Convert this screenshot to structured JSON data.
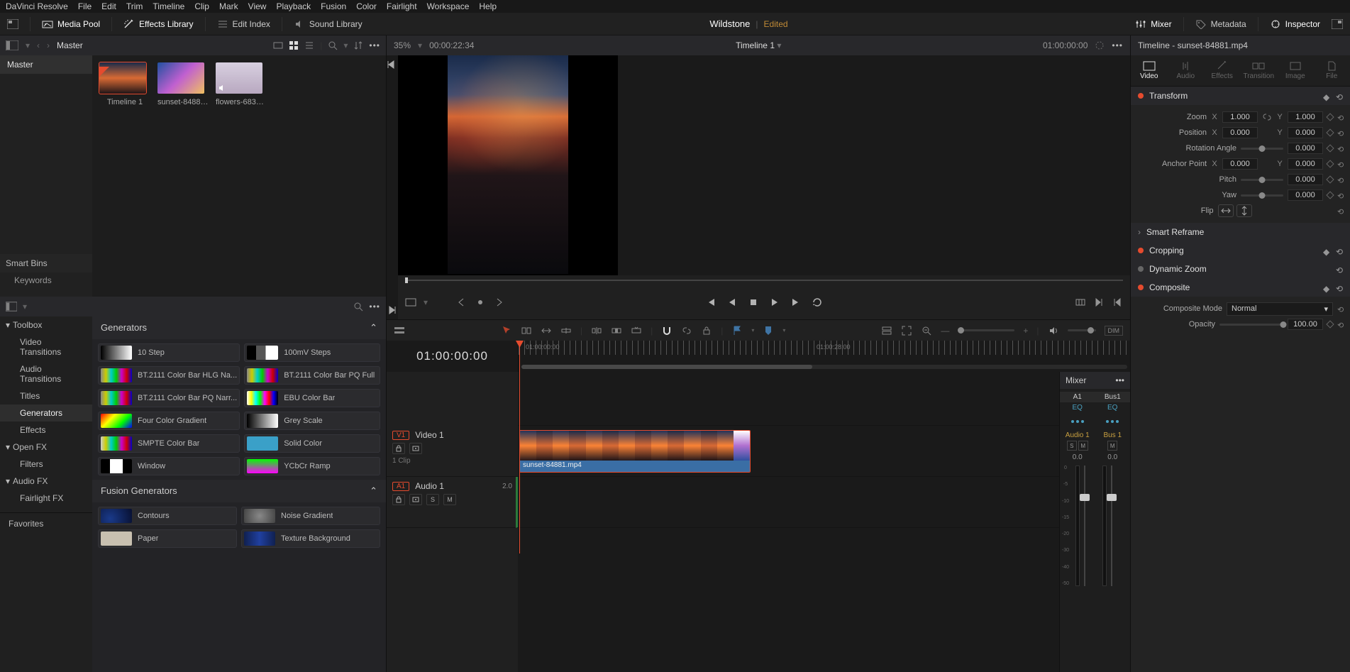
{
  "menu": [
    "DaVinci Resolve",
    "File",
    "Edit",
    "Trim",
    "Timeline",
    "Clip",
    "Mark",
    "View",
    "Playback",
    "Fusion",
    "Color",
    "Fairlight",
    "Workspace",
    "Help"
  ],
  "toolbar": {
    "media_pool": "Media Pool",
    "effects_lib": "Effects Library",
    "edit_index": "Edit Index",
    "sound_lib": "Sound Library",
    "mixer": "Mixer",
    "metadata": "Metadata",
    "inspector": "Inspector"
  },
  "project": {
    "name": "Wildstone",
    "status": "Edited"
  },
  "pool": {
    "title": "Master",
    "bin": "Master",
    "smart_bins": "Smart Bins",
    "keywords": "Keywords",
    "thumbs": [
      {
        "label": "Timeline 1",
        "selected": true,
        "type": "timeline"
      },
      {
        "label": "sunset-84881...",
        "type": "sunset"
      },
      {
        "label": "flowers-6836...",
        "type": "flowers"
      }
    ]
  },
  "fx": {
    "favorites": "Favorites",
    "cats": [
      {
        "label": "Toolbox",
        "group": true
      },
      {
        "label": "Video Transitions",
        "sub": true
      },
      {
        "label": "Audio Transitions",
        "sub": true
      },
      {
        "label": "Titles",
        "sub": true
      },
      {
        "label": "Generators",
        "sub": true,
        "sel": true
      },
      {
        "label": "Effects",
        "sub": true
      },
      {
        "label": "Open FX",
        "group": true
      },
      {
        "label": "Filters",
        "sub": true
      },
      {
        "label": "Audio FX",
        "group": true
      },
      {
        "label": "Fairlight FX",
        "sub": true
      }
    ],
    "sect1": "Generators",
    "items1": [
      {
        "name": "10 Step",
        "sw": "linear-gradient(90deg,#000,#fff)"
      },
      {
        "name": "100mV Steps",
        "sw": "linear-gradient(90deg,#000 0,#000 30%,#555 30%,#555 60%,#fff 60%)"
      },
      {
        "name": "BT.2111 Color Bar HLG Na...",
        "sw": "linear-gradient(90deg,#888,#cc0,#0cc,#0c0,#c0c,#c00,#00c)"
      },
      {
        "name": "BT.2111 Color Bar PQ Full",
        "sw": "linear-gradient(90deg,#888,#cc0,#0cc,#0c0,#c0c,#c00,#00c)"
      },
      {
        "name": "BT.2111 Color Bar PQ Narr...",
        "sw": "linear-gradient(90deg,#888,#cc0,#0cc,#0c0,#c0c,#c00,#00c)"
      },
      {
        "name": "EBU Color Bar",
        "sw": "linear-gradient(90deg,#fff,#ff0,#0ff,#0f0,#f0f,#f00,#00f,#000)"
      },
      {
        "name": "Four Color Gradient",
        "sw": "linear-gradient(135deg,#f00,#ff0,#0f0,#00f)"
      },
      {
        "name": "Grey Scale",
        "sw": "linear-gradient(90deg,#000,#fff)"
      },
      {
        "name": "SMPTE Color Bar",
        "sw": "linear-gradient(90deg,#ccc,#cc0,#0cc,#0c0,#c0c,#c00,#00c)"
      },
      {
        "name": "Solid Color",
        "sw": "#3aa0c8"
      },
      {
        "name": "Window",
        "sw": "linear-gradient(90deg,#000 0,#000 30%,#fff 30%,#fff 70%,#000 70%)"
      },
      {
        "name": "YCbCr Ramp",
        "sw": "linear-gradient(#0f0,#f0f)"
      }
    ],
    "sect2": "Fusion Generators",
    "items2": [
      {
        "name": "Contours",
        "sw": "radial-gradient(circle at 30% 70%,#1a3a8a,#081030)"
      },
      {
        "name": "Noise Gradient",
        "sw": "radial-gradient(circle,#888,#444)"
      },
      {
        "name": "Paper",
        "sw": "#c8c0b0"
      },
      {
        "name": "Texture Background",
        "sw": "linear-gradient(90deg,#102050,#2040a0,#102050)"
      }
    ]
  },
  "viewer": {
    "zoom": "35%",
    "duration": "00:00:22:34",
    "title": "Timeline 1",
    "tc": "01:00:00:00"
  },
  "timeline": {
    "tc": "01:00:00:00",
    "r1": "01:00:00:00",
    "r2": "01:00:28:00",
    "video_badge": "V1",
    "video_track": "Video 1",
    "clip_count": "1 Clip",
    "audio_badge": "A1",
    "audio_track": "Audio 1",
    "audio_ch": "2.0",
    "clip_name": "sunset-84881.mp4"
  },
  "mixer": {
    "title": "Mixer",
    "channels": [
      "A1",
      "Bus1"
    ],
    "eq": "EQ",
    "tracks": [
      "Audio 1",
      "Bus 1"
    ],
    "sm": [
      "S",
      "M"
    ],
    "db": "0.0",
    "scale": [
      "0",
      "-5",
      "-10",
      "-15",
      "-20",
      "-30",
      "-40",
      "-50"
    ]
  },
  "inspector": {
    "title": "Timeline - sunset-84881.mp4",
    "tabs": [
      "Video",
      "Audio",
      "Effects",
      "Transition",
      "Image",
      "File"
    ],
    "transform": "Transform",
    "zoom": "Zoom",
    "zoom_x": "1.000",
    "zoom_y": "1.000",
    "position": "Position",
    "pos_x": "0.000",
    "pos_y": "0.000",
    "rotation": "Rotation Angle",
    "rot_v": "0.000",
    "anchor": "Anchor Point",
    "anc_x": "0.000",
    "anc_y": "0.000",
    "pitch": "Pitch",
    "pitch_v": "0.000",
    "yaw": "Yaw",
    "yaw_v": "0.000",
    "flip": "Flip",
    "smart_reframe": "Smart Reframe",
    "cropping": "Cropping",
    "dynamic_zoom": "Dynamic Zoom",
    "composite": "Composite",
    "comp_mode": "Composite Mode",
    "comp_mode_v": "Normal",
    "opacity": "Opacity",
    "opacity_v": "100.00",
    "x": "X",
    "y": "Y"
  }
}
